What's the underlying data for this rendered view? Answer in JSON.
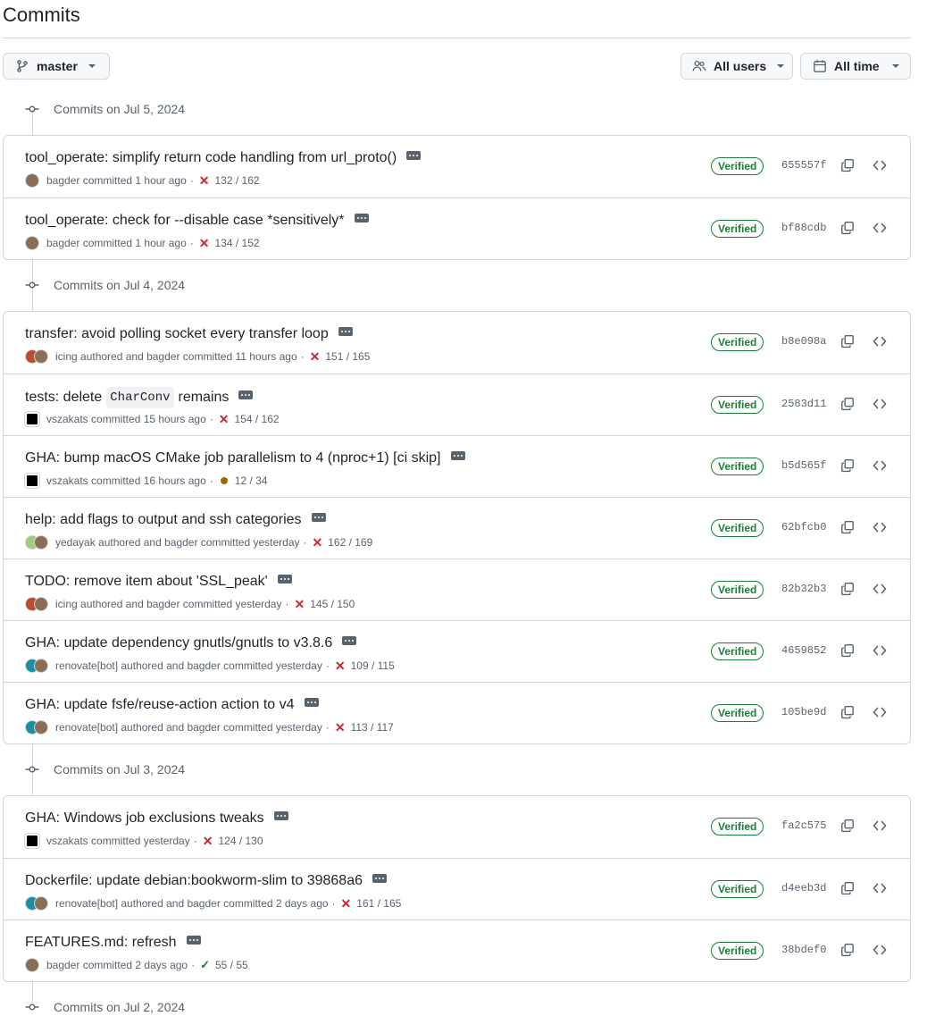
{
  "page": {
    "title": "Commits"
  },
  "filters": {
    "branch": "master",
    "users": "All users",
    "time": "All time"
  },
  "days": [
    {
      "label": "Commits on Jul 5, 2024",
      "commits": [
        {
          "title": "tool_operate: simplify return code handling from url_proto()",
          "avatars": [
            "bagder"
          ],
          "meta": "bagder committed 1 hour ago",
          "ci": "fail",
          "checks": "132 / 162",
          "verified": "Verified",
          "sha": "655557f"
        },
        {
          "title": "tool_operate: check for --disable case *sensitively*",
          "avatars": [
            "bagder"
          ],
          "meta": "bagder committed 1 hour ago",
          "ci": "fail",
          "checks": "134 / 152",
          "verified": "Verified",
          "sha": "bf88cdb"
        }
      ]
    },
    {
      "label": "Commits on Jul 4, 2024",
      "commits": [
        {
          "title": "transfer: avoid polling socket every transfer loop",
          "avatars": [
            "icing",
            "bagder"
          ],
          "meta": "icing authored and bagder committed 11 hours ago",
          "ci": "fail",
          "checks": "151 / 165",
          "verified": "Verified",
          "sha": "b8e098a"
        },
        {
          "title": "tests: delete",
          "title_code": "CharConv",
          "title_after": "remains",
          "avatars": [
            "vszakats"
          ],
          "meta": "vszakats committed 15 hours ago",
          "ci": "fail",
          "checks": "154 / 162",
          "verified": "Verified",
          "sha": "2583d11"
        },
        {
          "title": "GHA: bump macOS CMake job parallelism to 4 (nproc+1) [ci skip]",
          "avatars": [
            "vszakats"
          ],
          "meta": "vszakats committed 16 hours ago",
          "ci": "pending",
          "checks": "12 / 34",
          "verified": "Verified",
          "sha": "b5d565f"
        },
        {
          "title": "help: add flags to output and ssh categories",
          "avatars": [
            "yedayak",
            "bagder"
          ],
          "meta": "yedayak authored and bagder committed yesterday",
          "ci": "fail",
          "checks": "162 / 169",
          "verified": "Verified",
          "sha": "62bfcb0"
        },
        {
          "title": "TODO: remove item about 'SSL_peak'",
          "avatars": [
            "icing",
            "bagder"
          ],
          "meta": "icing authored and bagder committed yesterday",
          "ci": "fail",
          "checks": "145 / 150",
          "verified": "Verified",
          "sha": "82b32b3"
        },
        {
          "title": "GHA: update dependency gnutls/gnutls to v3.8.6",
          "avatars": [
            "renovate",
            "bagder"
          ],
          "meta": "renovate[bot] authored and bagder committed yesterday",
          "ci": "fail",
          "checks": "109 / 115",
          "verified": "Verified",
          "sha": "4659852"
        },
        {
          "title": "GHA: update fsfe/reuse-action action to v4",
          "avatars": [
            "renovate",
            "bagder"
          ],
          "meta": "renovate[bot] authored and bagder committed yesterday",
          "ci": "fail",
          "checks": "113 / 117",
          "verified": "Verified",
          "sha": "105be9d"
        }
      ]
    },
    {
      "label": "Commits on Jul 3, 2024",
      "commits": [
        {
          "title": "GHA: Windows job exclusions tweaks",
          "avatars": [
            "vszakats"
          ],
          "meta": "vszakats committed yesterday",
          "ci": "fail",
          "checks": "124 / 130",
          "verified": "Verified",
          "sha": "fa2c575"
        },
        {
          "title": "Dockerfile: update debian:bookworm-slim to 39868a6",
          "avatars": [
            "renovate",
            "bagder"
          ],
          "meta": "renovate[bot] authored and bagder committed 2 days ago",
          "ci": "fail",
          "checks": "161 / 165",
          "verified": "Verified",
          "sha": "d4eeb3d"
        },
        {
          "title": "FEATURES.md: refresh",
          "avatars": [
            "bagder"
          ],
          "meta": "bagder committed 2 days ago",
          "ci": "success",
          "checks": "55 / 55",
          "verified": "Verified",
          "sha": "38bdef0"
        }
      ]
    },
    {
      "label": "Commits on Jul 2, 2024",
      "commits": []
    }
  ],
  "colors": {
    "verified": "#1a7f37",
    "fail": "#d1242f",
    "pending": "#9a6700",
    "muted": "#59636e",
    "border": "#d0d7de"
  },
  "icons": {
    "branch": "git-branch-icon",
    "users": "people-icon",
    "time": "calendar-icon",
    "commit": "git-commit-icon",
    "copy": "copy-icon",
    "browse": "code-icon",
    "ellipsis": "kebab-ellipsis-icon"
  }
}
